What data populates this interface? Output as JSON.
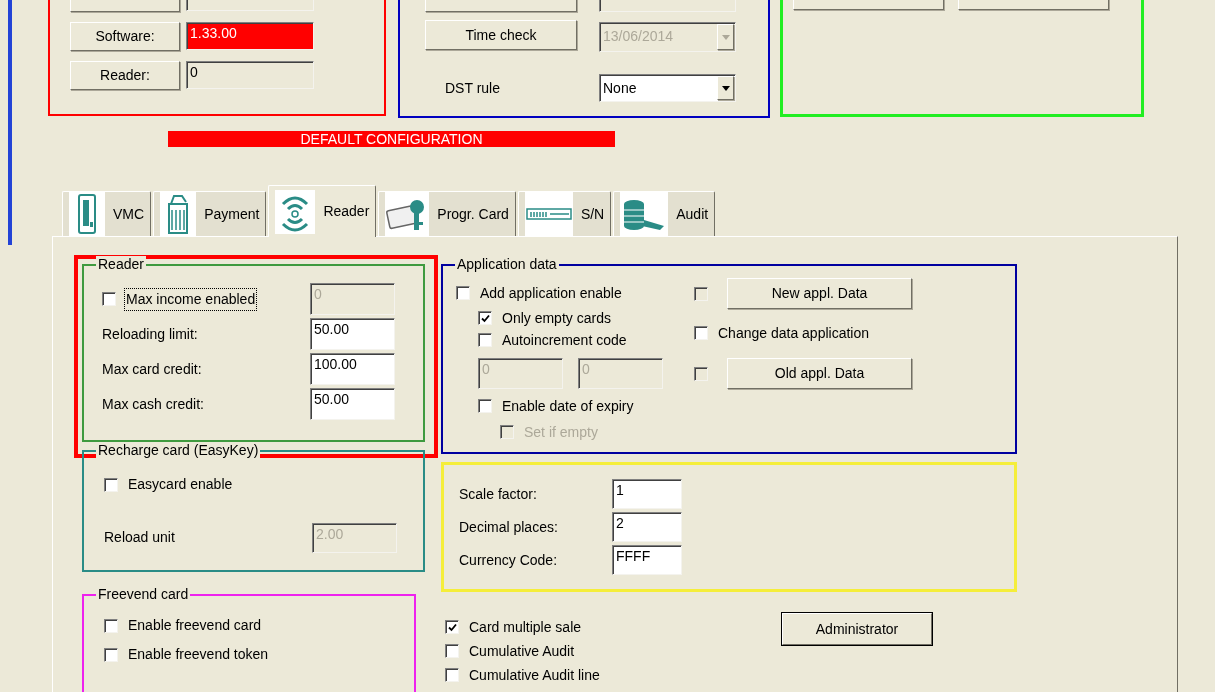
{
  "device_panel": {
    "rows": [
      {
        "button": "Software:",
        "value": "1.33.00",
        "alert": true
      },
      {
        "button": "Reader:",
        "value": "0",
        "alert": false
      }
    ]
  },
  "clock_panel": {
    "time_check": "Time check",
    "date": {
      "value": "13/06/2014",
      "disabled": true
    },
    "dst": {
      "label": "DST rule",
      "value": "None",
      "disabled": false
    }
  },
  "banner": "DEFAULT CONFIGURATION",
  "tabs": [
    {
      "label": "VMC",
      "kind": "vmc",
      "selected": false
    },
    {
      "label": "Payment",
      "kind": "payment",
      "selected": false
    },
    {
      "label": "Reader",
      "kind": "reader",
      "selected": true
    },
    {
      "label": "Progr. Card",
      "kind": "card",
      "selected": false
    },
    {
      "label": "S/N",
      "kind": "serial",
      "selected": false
    },
    {
      "label": "Audit",
      "kind": "audit",
      "selected": false
    }
  ],
  "reader_group": {
    "title": "Reader",
    "highlighted": true,
    "max_income": {
      "label": "Max income enabled",
      "checked": false,
      "focused": true,
      "field": {
        "value": "0",
        "disabled": true
      }
    },
    "fields": [
      {
        "label": "Reloading limit:",
        "value": "50.00"
      },
      {
        "label": "Max card credit:",
        "value": "100.00"
      },
      {
        "label": "Max cash credit:",
        "value": "50.00"
      }
    ]
  },
  "recharge_group": {
    "title": "Recharge card (EasyKey)",
    "easycard": {
      "label": "Easycard enable",
      "checked": false
    },
    "reload_unit": {
      "label": "Reload unit",
      "value": "2.00",
      "disabled": true
    }
  },
  "freevend_group": {
    "title": "Freevend card",
    "options": [
      {
        "label": "Enable freevend card",
        "checked": false
      },
      {
        "label": "Enable freevend token",
        "checked": false
      }
    ]
  },
  "application_group": {
    "title": "Application data",
    "add": {
      "label": "Add application enable",
      "checked": false
    },
    "only_empty": {
      "label": "Only empty cards",
      "checked": true
    },
    "autoincrement": {
      "label": "Autoincrement code",
      "checked": false
    },
    "codes": [
      {
        "value": "0",
        "disabled": true
      },
      {
        "value": "0",
        "disabled": true
      }
    ],
    "expiry": {
      "label": "Enable date of expiry",
      "checked": false
    },
    "set_if_empty": {
      "label": "Set if empty",
      "checked": false,
      "disabled": true
    },
    "new_data": {
      "checked": false,
      "disabled": true,
      "button": "New appl. Data"
    },
    "change_data": {
      "label": "Change data application",
      "checked": false
    },
    "old_data": {
      "checked": false,
      "disabled": true,
      "button": "Old appl. Data"
    }
  },
  "currency_group": {
    "fields": [
      {
        "label": "Scale factor:",
        "value": "1"
      },
      {
        "label": "Decimal places:",
        "value": "2"
      },
      {
        "label": "Currency Code:",
        "value": "FFFF"
      }
    ]
  },
  "options": [
    {
      "label": "Card multiple sale",
      "checked": true
    },
    {
      "label": "Cumulative Audit",
      "checked": false
    },
    {
      "label": "Cumulative Audit line",
      "checked": false
    }
  ],
  "admin_button": "Administrator"
}
